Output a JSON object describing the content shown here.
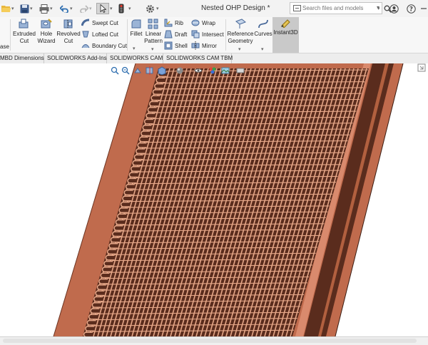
{
  "window": {
    "title": "Nested OHP Design *"
  },
  "search": {
    "placeholder": "Search files and models"
  },
  "ribbon": {
    "partial_label": "ase",
    "extruded_cut": [
      "Extruded",
      "Cut"
    ],
    "hole_wizard": [
      "Hole",
      "Wizard"
    ],
    "revolved_cut": [
      "Revolved",
      "Cut"
    ],
    "swept_cut": "Swept Cut",
    "lofted_cut": "Lofted Cut",
    "boundary_cut": "Boundary Cut",
    "fillet": "Fillet",
    "linear_pattern": [
      "Linear",
      "Pattern"
    ],
    "rib": "Rib",
    "draft": "Draft",
    "shell": "Shell",
    "wrap": "Wrap",
    "intersect": "Intersect",
    "mirror": "Mirror",
    "reference_geometry": [
      "Reference",
      "Geometry"
    ],
    "curves": "Curves",
    "instant3d": "Instant3D"
  },
  "tabs": [
    "MBD Dimensions",
    "SOLIDWORKS Add-Ins",
    "SOLIDWORKS CAM",
    "SOLIDWORKS CAM TBM"
  ],
  "icons": {
    "titlebar": [
      "open-folder-icon",
      "save-icon",
      "print-icon",
      "undo-icon",
      "redo-icon",
      "select-arrow-icon",
      "traffic-light-icon",
      "options-gear-icon"
    ],
    "right": [
      "user-icon",
      "help-icon",
      "minimize-icon"
    ],
    "view_toolbar": [
      "zoom-to-fit-icon",
      "zoom-area-icon",
      "previous-view-icon",
      "section-view-icon",
      "view-orientation-icon",
      "display-style-icon",
      "hide-show-icon",
      "edit-appearance-icon",
      "scene-icon",
      "view-settings-icon"
    ]
  },
  "colors": {
    "copper_dark": "#5a2c1d",
    "copper_mid": "#c06b4d",
    "copper_light": "#d98a6d",
    "tube_line": "#e6a788",
    "ribbon_bg": "#f7f7f7",
    "selected_tool_bg": "#c9c9c9"
  }
}
